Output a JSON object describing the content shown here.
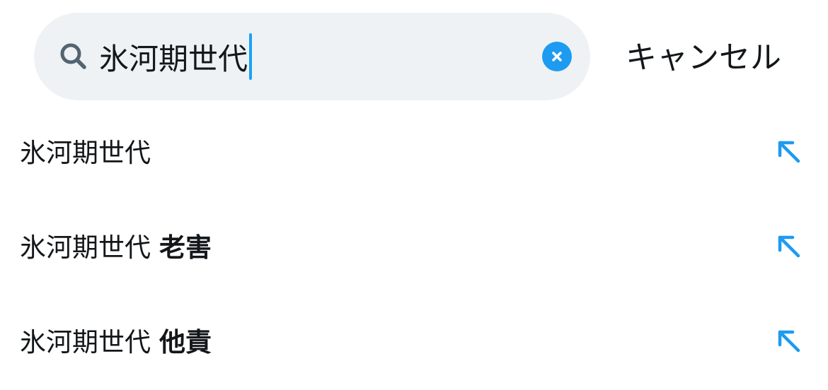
{
  "search": {
    "query": "氷河期世代",
    "clear_icon": "clear-x-icon",
    "search_icon": "magnifier-icon"
  },
  "cancel_label": "キャンセル",
  "suggestions": [
    {
      "base": "氷河期世代",
      "extra": ""
    },
    {
      "base": "氷河期世代",
      "extra": "老害"
    },
    {
      "base": "氷河期世代",
      "extra": "他責"
    }
  ],
  "colors": {
    "accent": "#1d9bf0",
    "search_bg": "#eef2f4",
    "text": "#14171a"
  }
}
